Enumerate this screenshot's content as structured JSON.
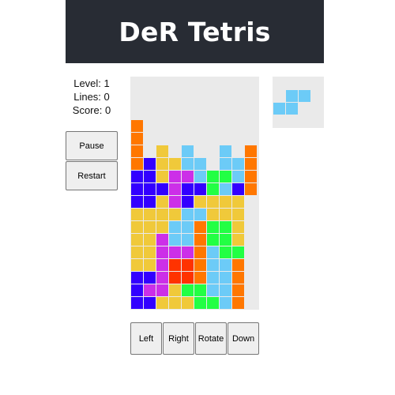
{
  "header": {
    "title": "DeR Tetris"
  },
  "stats": {
    "level": "Level: 1",
    "lines": "Lines: 0",
    "score": "Score: 0"
  },
  "buttons": {
    "pause": "Pause",
    "restart": "Restart",
    "left": "Left",
    "right": "Right",
    "rotate": "Rotate",
    "down": "Down"
  },
  "palette": {
    "O": "#ff7700",
    "Y": "#f0c93a",
    "C": "#6ccbf7",
    "B": "#3300ff",
    "P": "#cc2fe8",
    "G": "#22ff44",
    "R": "#ff3300"
  },
  "board": {
    "cols": 10,
    "rows": 18,
    "grid": [
      "..........",
      "..........",
      "..........",
      "..........",
      "O.........",
      "O.........",
      "O.Y.C..C.O",
      "OBYYCC.CCO",
      "BBYPPCGGCO",
      "BBBPBBGCBO",
      "BBYPBYYYY.",
      "YYYYCCYYY.",
      "YYYCCOGGY.",
      "YYPCCOGGY.",
      "YYPPPOCGG.",
      "YYPRROCCO.",
      "BBPRROCCO.",
      "BPPYGGCCO.",
      "BBYYYGGCO."
    ]
  },
  "next_piece": {
    "grid": [
      ".CC",
      "CC."
    ]
  }
}
